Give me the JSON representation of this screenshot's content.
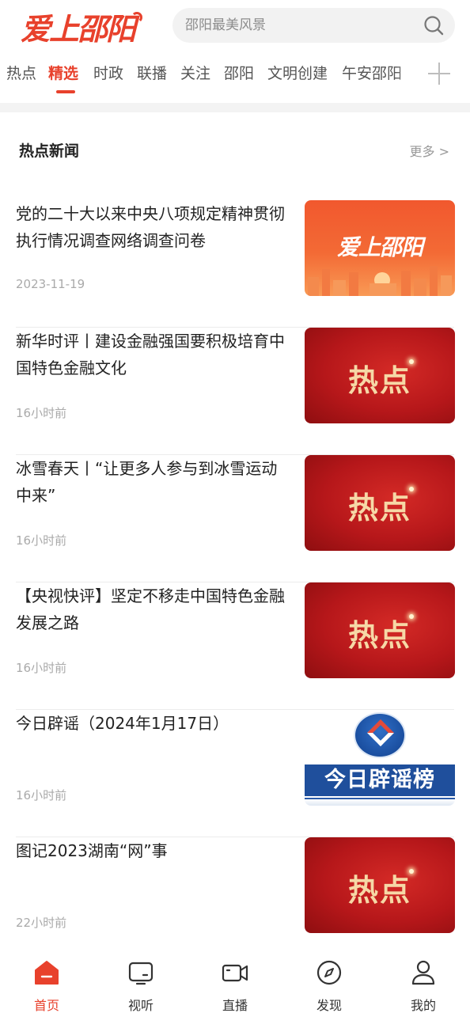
{
  "header": {
    "logo_text": "爱上邵阳",
    "search_placeholder": "邵阳最美风景"
  },
  "tabs": [
    {
      "label": "热点",
      "active": false
    },
    {
      "label": "精选",
      "active": true
    },
    {
      "label": "时政",
      "active": false
    },
    {
      "label": "联播",
      "active": false
    },
    {
      "label": "关注",
      "active": false
    },
    {
      "label": "邵阳",
      "active": false
    },
    {
      "label": "文明创建",
      "active": false
    },
    {
      "label": "午安邵阳",
      "active": false
    }
  ],
  "section": {
    "title": "热点新闻",
    "more_label": "更多 >"
  },
  "news": [
    {
      "title": "党的二十大以来中央八项规定精神贯彻执行情况调查网络调查问卷",
      "time": "2023-11-19",
      "thumb": "brand",
      "thumb_text": "爱上邵阳"
    },
    {
      "title": "新华时评丨建设金融强国要积极培育中国特色金融文化",
      "time": "16小时前",
      "thumb": "hot",
      "thumb_text": "热点"
    },
    {
      "title": "冰雪春天丨“让更多人参与到冰雪运动中来”",
      "time": "16小时前",
      "thumb": "hot",
      "thumb_text": "热点"
    },
    {
      "title": "【央视快评】坚定不移走中国特色金融发展之路",
      "time": "16小时前",
      "thumb": "hot",
      "thumb_text": "热点"
    },
    {
      "title": "今日辟谣（2024年1月17日）",
      "time": "16小时前",
      "thumb": "rumor",
      "thumb_text": "今日辟谣榜"
    },
    {
      "title": "图记2023湖南“网”事",
      "time": "22小时前",
      "thumb": "hot",
      "thumb_text": "热点"
    }
  ],
  "bottom_nav": [
    {
      "label": "首页",
      "icon": "home-icon",
      "active": true
    },
    {
      "label": "视听",
      "icon": "tv-icon",
      "active": false
    },
    {
      "label": "直播",
      "icon": "video-camera-icon",
      "active": false
    },
    {
      "label": "发现",
      "icon": "compass-icon",
      "active": false
    },
    {
      "label": "我的",
      "icon": "user-icon",
      "active": false
    }
  ],
  "colors": {
    "accent": "#e8412c",
    "hot_thumb_red": "#b6171a",
    "hot_text_gold": "#f6d8a6",
    "rumor_blue": "#1f4f9c"
  }
}
